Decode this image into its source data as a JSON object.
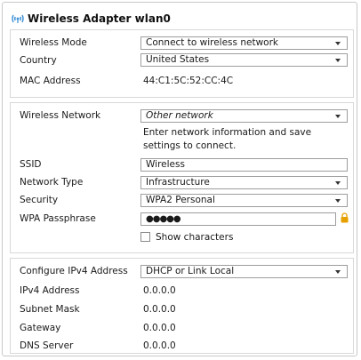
{
  "header": {
    "title": "Wireless Adapter wlan0",
    "icon": "wireless-signal-icon"
  },
  "adapter": {
    "wireless_mode_label": "Wireless Mode",
    "wireless_mode_value": "Connect to wireless network",
    "country_label": "Country",
    "country_value": "United States",
    "mac_label": "MAC Address",
    "mac_value": "44:C1:5C:52:CC:4C"
  },
  "network": {
    "wireless_network_label": "Wireless Network",
    "wireless_network_value": "Other network",
    "info_text": "Enter network information and save settings to connect.",
    "ssid_label": "SSID",
    "ssid_value": "Wireless",
    "network_type_label": "Network Type",
    "network_type_value": "Infrastructure",
    "security_label": "Security",
    "security_value": "WPA2 Personal",
    "passphrase_label": "WPA Passphrase",
    "passphrase_value": "●●●●●",
    "show_characters_label": "Show characters",
    "show_characters_checked": false,
    "lock_icon": "lock-icon",
    "lock_color": "#e6a100"
  },
  "ipv4": {
    "configure_label": "Configure IPv4 Address",
    "configure_value": "DHCP or Link Local",
    "address_label": "IPv4 Address",
    "address_value": "0.0.0.0",
    "subnet_label": "Subnet Mask",
    "subnet_value": "0.0.0.0",
    "gateway_label": "Gateway",
    "gateway_value": "0.0.0.0",
    "dns_label": "DNS Server",
    "dns_value": "0.0.0.0"
  },
  "colors": {
    "wifi_icon": "#3a8fd6",
    "border": "#d8d8d8"
  }
}
